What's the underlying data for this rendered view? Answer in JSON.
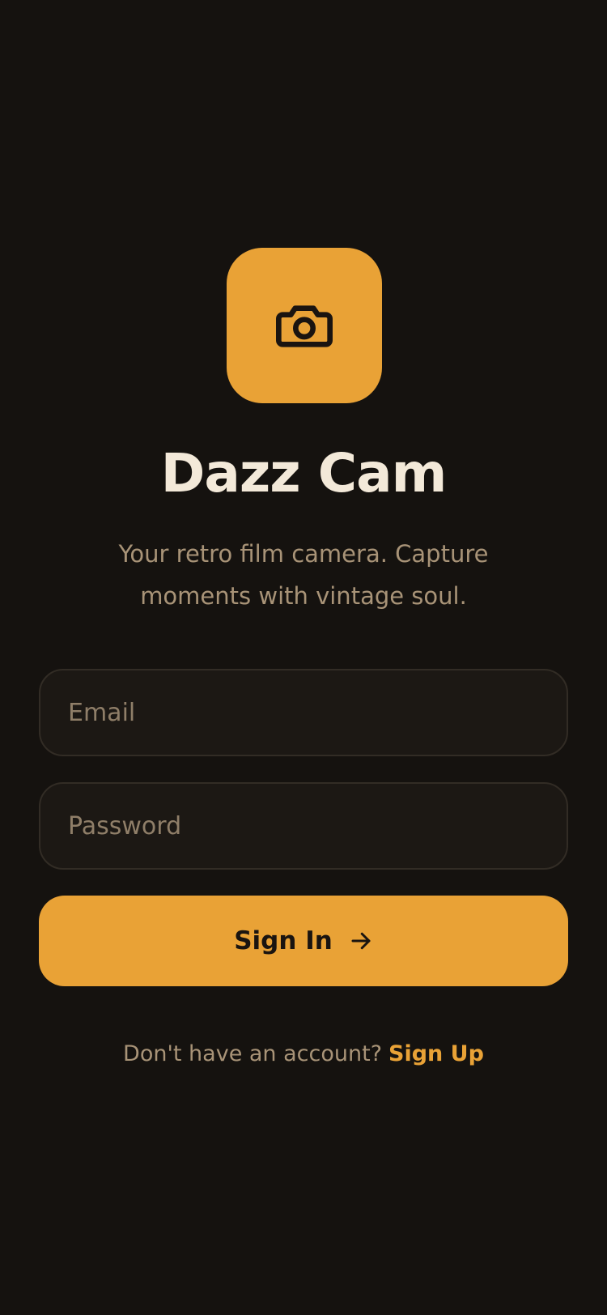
{
  "app": {
    "title": "Dazz Cam",
    "tagline": "Your retro film camera. Capture moments with vintage soul.",
    "logo_icon": "camera-icon"
  },
  "form": {
    "email": {
      "placeholder": "Email",
      "value": ""
    },
    "password": {
      "placeholder": "Password",
      "value": ""
    },
    "submit_label": "Sign In",
    "submit_icon": "arrow-right-icon"
  },
  "footer": {
    "prompt": "Don't have an account?",
    "link_label": "Sign Up"
  },
  "colors": {
    "background": "#15120f",
    "accent": "#e9a236",
    "title_text": "#f3e9d9",
    "muted_text": "#a89377",
    "field_background": "#1c1814",
    "field_border": "#322c25"
  }
}
